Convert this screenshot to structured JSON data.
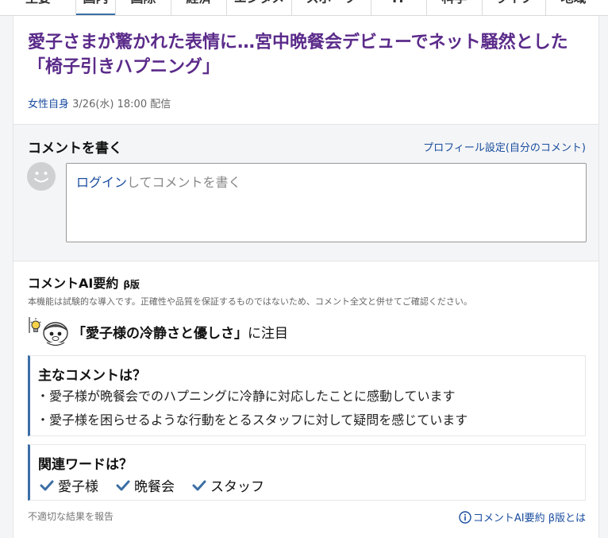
{
  "tabs": [
    {
      "label": "主要",
      "active": false
    },
    {
      "label": "国内",
      "active": true
    },
    {
      "label": "国際",
      "active": false
    },
    {
      "label": "経済",
      "active": false
    },
    {
      "label": "エンタメ",
      "active": false
    },
    {
      "label": "スポーツ",
      "active": false
    },
    {
      "label": "IT",
      "active": false
    },
    {
      "label": "科学",
      "active": false
    },
    {
      "label": "ライフ",
      "active": false
    },
    {
      "label": "地域",
      "active": false
    }
  ],
  "article": {
    "title": "愛子さまが驚かれた表情に…宮中晩餐会デビューでネット騒然とした「椅子引きハプニング」",
    "source": "女性自身",
    "date": "3/26(水) 18:00",
    "delivered": "配信"
  },
  "comment": {
    "heading": "コメントを書く",
    "profile_link": "プロフィール設定(自分のコメント)",
    "login_link": "ログイン",
    "placeholder_rest": "してコメントを書く"
  },
  "ai_summary": {
    "heading": "コメントAI要約",
    "beta": "β版",
    "notice": "本機能は試験的な導入です。正確性や品質を保証するものではないため、コメント全文と併せてご確認ください。",
    "topic": "「愛子様の冷静さと優しさ」",
    "topic_suffix": "に注目",
    "main_title": "主なコメントは？",
    "main_items": [
      "愛子様が晩餐会でのハプニングに冷静に対応したことに感動しています",
      "愛子様を困らせるような行動をとるスタッフに対して疑問を感じています"
    ],
    "words_title": "関連ワードは？",
    "words": [
      "愛子様",
      "晩餐会",
      "スタッフ"
    ],
    "report_link": "不適切な結果を報告",
    "about_link": "コメントAI要約 β版とは"
  },
  "colors": {
    "title_purple": "#5b2b8a",
    "link_blue": "#1a4da0",
    "accent_blue": "#3c6ea5"
  }
}
